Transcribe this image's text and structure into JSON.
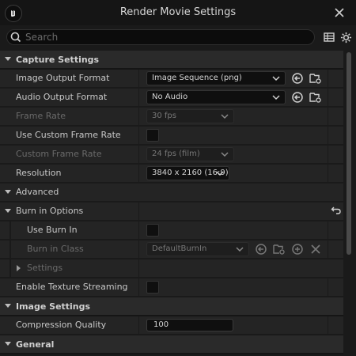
{
  "window": {
    "title": "Render Movie Settings"
  },
  "search": {
    "placeholder": "Search",
    "value": ""
  },
  "categories": {
    "capture": "Capture Settings",
    "advanced": "Advanced",
    "image": "Image Settings",
    "general": "General"
  },
  "capture": {
    "image_output_format": {
      "label": "Image Output Format",
      "value": "Image Sequence (png)"
    },
    "audio_output_format": {
      "label": "Audio Output Format",
      "value": "No Audio"
    },
    "frame_rate": {
      "label": "Frame Rate",
      "value": "30 fps"
    },
    "use_custom_frame_rate": {
      "label": "Use Custom Frame Rate",
      "checked": false
    },
    "custom_frame_rate": {
      "label": "Custom Frame Rate",
      "value": "24 fps (film)"
    },
    "resolution": {
      "label": "Resolution",
      "value": "3840 x 2160 (16:9)"
    }
  },
  "advanced": {
    "burn_in_options": {
      "label": "Burn in Options"
    },
    "use_burn_in": {
      "label": "Use Burn In",
      "checked": false
    },
    "burn_in_class": {
      "label": "Burn in Class",
      "value": "DefaultBurnIn"
    },
    "settings": {
      "label": "Settings"
    },
    "enable_texture_streaming": {
      "label": "Enable Texture Streaming",
      "checked": false
    }
  },
  "image": {
    "compression_quality": {
      "label": "Compression Quality",
      "value": "100"
    }
  },
  "icons": {
    "logo": "unreal-logo-icon",
    "close": "close-icon",
    "search": "search-icon",
    "table_view": "table-view-icon",
    "settings": "gear-icon",
    "use_selected": "use-selected-icon",
    "browse": "browse-folder-icon",
    "add": "add-icon",
    "clear": "clear-icon",
    "reset": "reset-to-default-icon"
  },
  "colors": {
    "background": "#1a1a1a",
    "category_bg": "#2a2a2a",
    "row_bg": "#242424",
    "text": "#c8c8c8",
    "disabled_text": "#6a6a6a"
  }
}
